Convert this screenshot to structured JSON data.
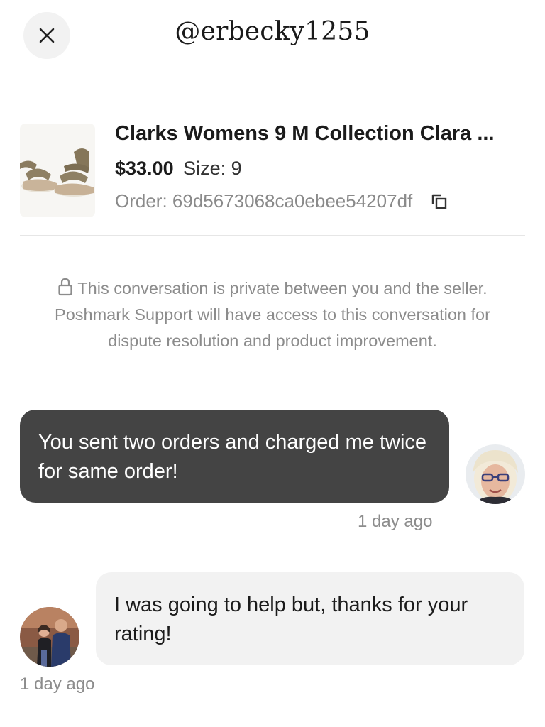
{
  "header": {
    "title": "@erbecky1255",
    "close_icon": "close-icon"
  },
  "product": {
    "title": "Clarks Womens 9 M Collection Clara ...",
    "price": "$33.00",
    "size": "Size: 9",
    "order": "Order: 69d5673068ca0ebee54207df",
    "copy_icon": "copy-icon"
  },
  "notice": {
    "lock_icon": "lock-icon",
    "text": "This conversation is private between you and the seller. Poshmark Support will have access to this conversation for dispute resolution and product improvement."
  },
  "messages": [
    {
      "text": "You sent two orders and charged me twice for same order!",
      "time": "1 day ago"
    },
    {
      "text": "I was going to help but, thanks for your rating!",
      "time": "1 day ago"
    }
  ],
  "colors": {
    "dark_bubble": "#444444",
    "light_bubble": "#f2f2f2",
    "muted_text": "#8c8c8c"
  }
}
